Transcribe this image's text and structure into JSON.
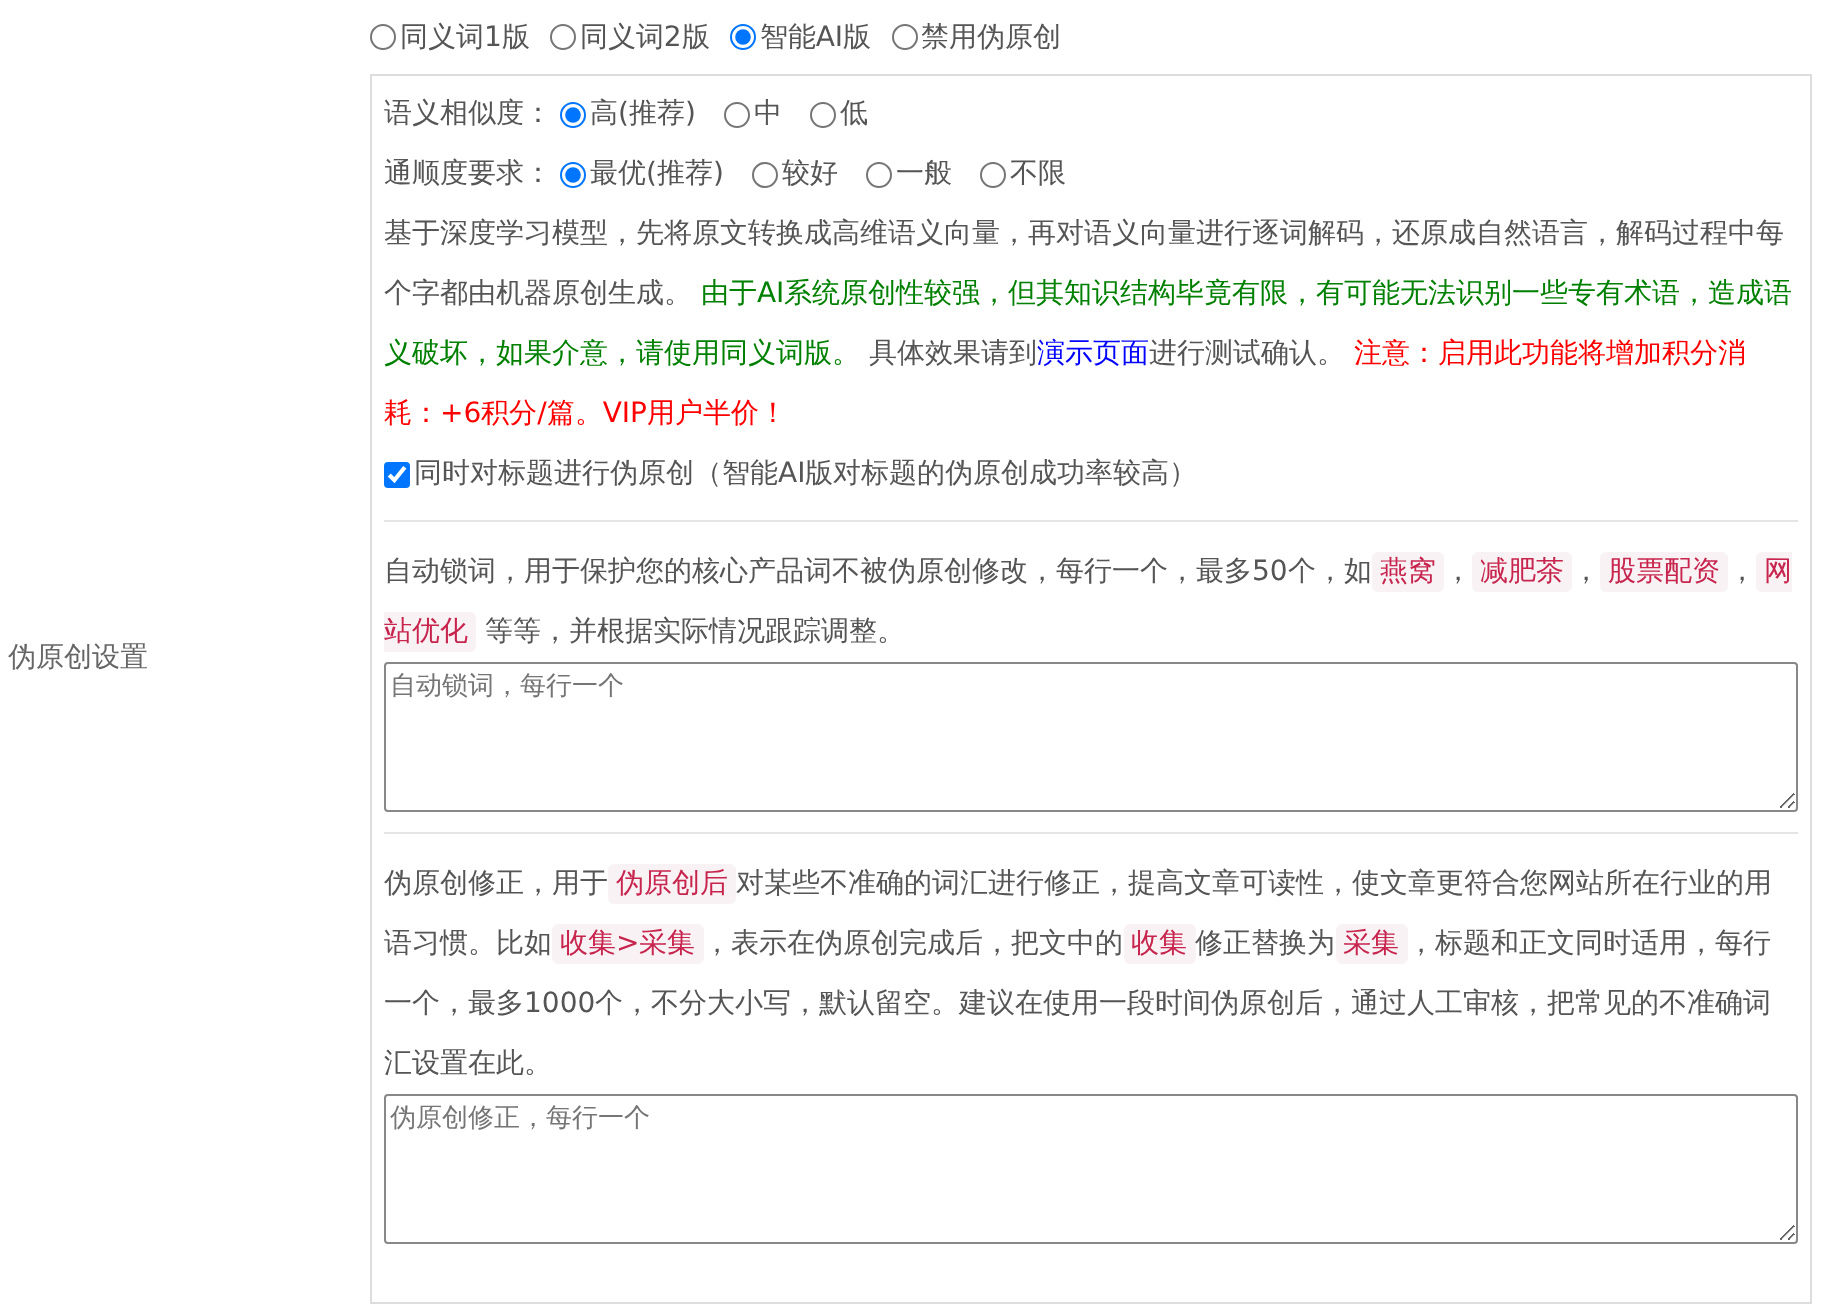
{
  "settings_label": "伪原创设置",
  "mode_options": [
    {
      "label": "同义词1版",
      "selected": false
    },
    {
      "label": "同义词2版",
      "selected": false
    },
    {
      "label": "智能AI版",
      "selected": true
    },
    {
      "label": "禁用伪原创",
      "selected": false
    }
  ],
  "similarity": {
    "label": "语义相似度：",
    "options": [
      {
        "label": "高(推荐)",
        "selected": true
      },
      {
        "label": "中",
        "selected": false
      },
      {
        "label": "低",
        "selected": false
      }
    ]
  },
  "fluency": {
    "label": "通顺度要求：",
    "options": [
      {
        "label": "最优(推荐)",
        "selected": true
      },
      {
        "label": "较好",
        "selected": false
      },
      {
        "label": "一般",
        "selected": false
      },
      {
        "label": "不限",
        "selected": false
      }
    ]
  },
  "description": [
    {
      "kind": "text",
      "text": "基于深度学习模型，先将原文转换成高维语义向量，再对语义向量进行逐词解码，还原成自然语言，解码过程中每个字都由机器原创生成。 "
    },
    {
      "kind": "note",
      "text": "由于AI系统原创性较强，但其知识结构毕竟有限，有可能无法识别一些专有术语，造成语义破坏，如果介意，请使用同义词版。"
    },
    {
      "kind": "text",
      "text": " 具体效果请到"
    },
    {
      "kind": "link",
      "text": "演示页面"
    },
    {
      "kind": "text",
      "text": "进行测试确认。 "
    },
    {
      "kind": "warning",
      "text": "注意：启用此功能将增加积分消耗：+6积分/篇。VIP用户半价！"
    }
  ],
  "title_checkbox": {
    "label": "同时对标题进行伪原创（智能AI版对标题的伪原创成功率较高）",
    "checked": true
  },
  "lock_words": {
    "description": [
      {
        "kind": "text",
        "text": "自动锁词，用于保护您的核心产品词不被伪原创修改，每行一个，最多50个，如"
      },
      {
        "kind": "code",
        "text": "燕窝"
      },
      {
        "kind": "text",
        "text": "，"
      },
      {
        "kind": "code",
        "text": "减肥茶"
      },
      {
        "kind": "text",
        "text": "，"
      },
      {
        "kind": "code",
        "text": "股票配资"
      },
      {
        "kind": "text",
        "text": "，"
      },
      {
        "kind": "code",
        "text": "网站优化"
      },
      {
        "kind": "text",
        "text": " 等等，并根据实际情况跟踪调整。"
      }
    ],
    "placeholder": "自动锁词，每行一个"
  },
  "corrections": {
    "description": [
      {
        "kind": "text",
        "text": "伪原创修正，用于"
      },
      {
        "kind": "code",
        "text": "伪原创后"
      },
      {
        "kind": "text",
        "text": "对某些不准确的词汇进行修正，提高文章可读性，使文章更符合您网站所在行业的用语习惯。比如"
      },
      {
        "kind": "code",
        "text": "收集>采集"
      },
      {
        "kind": "text",
        "text": "，表示在伪原创完成后，把文中的"
      },
      {
        "kind": "code",
        "text": "收集"
      },
      {
        "kind": "text",
        "text": "修正替换为"
      },
      {
        "kind": "code",
        "text": "采集"
      },
      {
        "kind": "text",
        "text": "，标题和正文同时适用，每行一个，最多1000个，不分大小写，默认留空。建议在使用一段时间伪原创后，通过人工审核，把常见的不准确词汇设置在此。"
      }
    ],
    "placeholder": "伪原创修正，每行一个"
  }
}
